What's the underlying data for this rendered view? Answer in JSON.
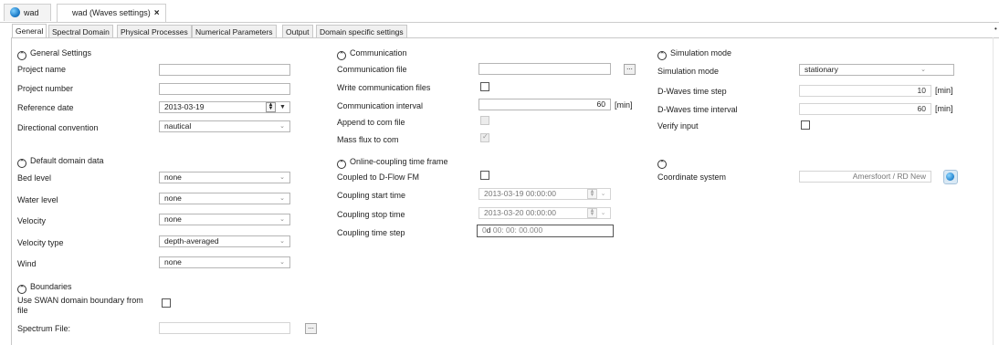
{
  "doc_tabs": [
    {
      "label": "wad"
    },
    {
      "label": "wad (Waves settings)",
      "close": "×"
    }
  ],
  "tabs": [
    "General",
    "Spectral Domain",
    "Physical Processes",
    "Numerical Parameters",
    "Output",
    "Domain specific settings"
  ],
  "general_settings": {
    "title": "General Settings",
    "project_name_label": "Project name",
    "project_name": "",
    "project_number_label": "Project number",
    "project_number": "",
    "reference_date_label": "Reference date",
    "reference_date": "2013-03-19",
    "directional_convention_label": "Directional convention",
    "directional_convention": "nautical"
  },
  "default_domain": {
    "title": "Default domain data",
    "rows": [
      {
        "label": "Bed level",
        "value": "none"
      },
      {
        "label": "Water level",
        "value": "none"
      },
      {
        "label": "Velocity",
        "value": "none"
      },
      {
        "label": "Velocity type",
        "value": "depth-averaged"
      },
      {
        "label": "Wind",
        "value": "none"
      }
    ]
  },
  "boundaries": {
    "title": "Boundaries",
    "use_swan_label": "Use SWAN domain boundary from file",
    "spectrum_file_label": "Spectrum File:",
    "browse": "..."
  },
  "communication": {
    "title": "Communication",
    "file_label": "Communication file",
    "file": "",
    "browse": "...",
    "write_label": "Write communication files",
    "interval_label": "Communication interval",
    "interval": "60",
    "interval_unit": "[min]",
    "append_label": "Append to com file",
    "mass_flux_label": "Mass flux to com"
  },
  "online_coupling": {
    "title": "Online-coupling time frame",
    "coupled_label": "Coupled to D-Flow FM",
    "start_label": "Coupling start time",
    "start": "2013-03-19 00:00:00",
    "stop_label": "Coupling stop time",
    "stop": "2013-03-20 00:00:00",
    "step_label": "Coupling time step",
    "step_days": "0",
    "step_rest": "00: 00: 00.000"
  },
  "simulation": {
    "title": "Simulation mode",
    "mode_label": "Simulation mode",
    "mode": "stationary",
    "timestep_label": "D-Waves time step",
    "timestep": "10",
    "timestep_unit": "[min]",
    "interval_label": "D-Waves time interval",
    "interval": "60",
    "interval_unit": "[min]",
    "verify_label": "Verify input"
  },
  "coordinates": {
    "label": "Coordinate system",
    "value": "Amersfoort / RD New"
  },
  "icons": {
    "chevron": "chevron-up-icon",
    "spin": "spinner-icon",
    "dropdown": "chevron-down-icon",
    "globe": "globe-icon"
  }
}
